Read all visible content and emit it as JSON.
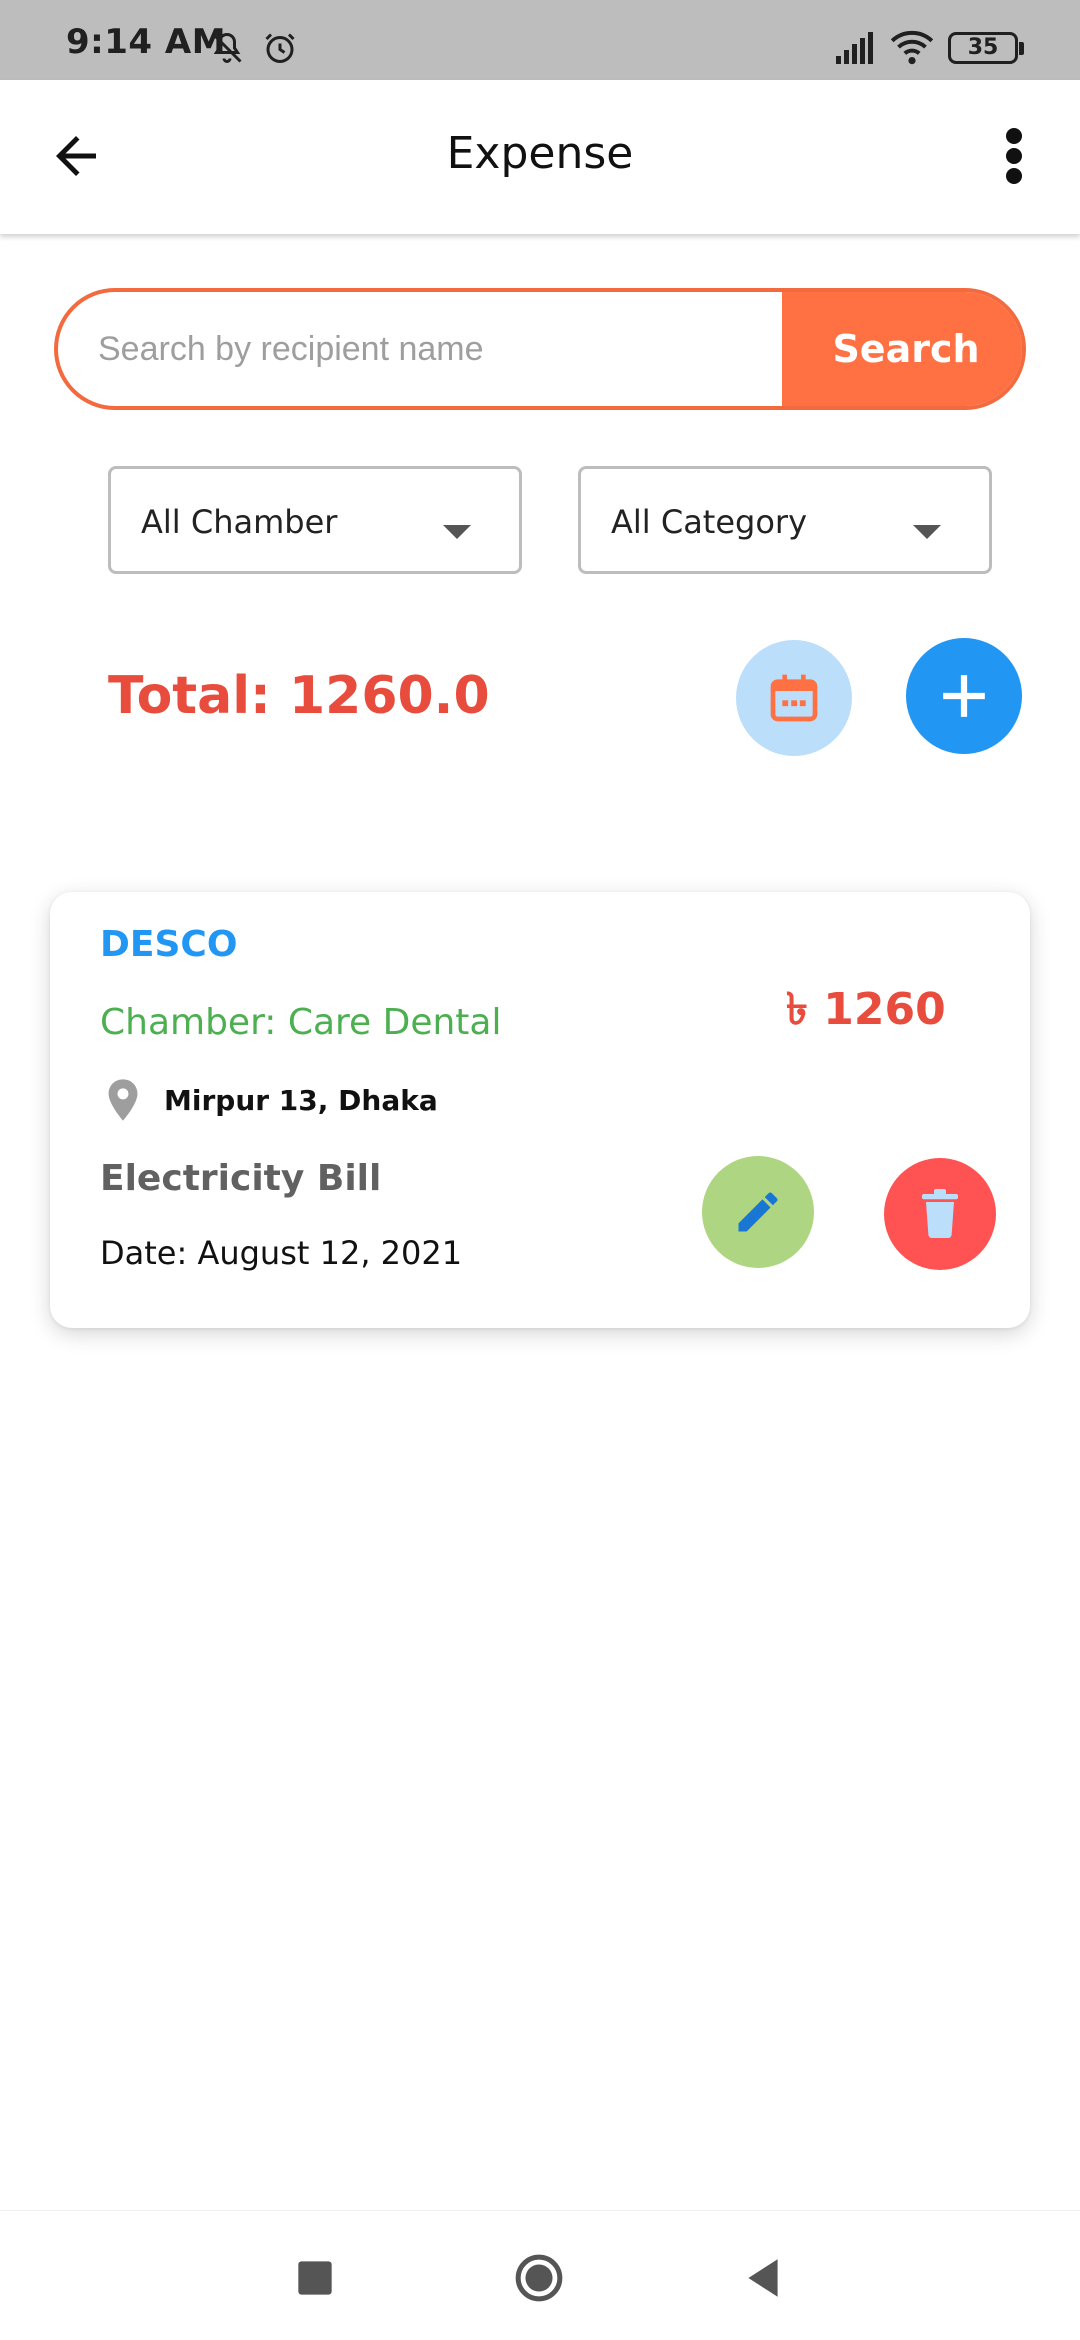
{
  "status_bar": {
    "time": "9:14 AM",
    "battery": "35",
    "icons": [
      "mute-icon",
      "alarm-icon",
      "signal-icon",
      "wifi-icon",
      "battery-icon"
    ]
  },
  "app_bar": {
    "title": "Expense",
    "icons": [
      "back-arrow-icon",
      "more-vert-icon"
    ]
  },
  "search": {
    "placeholder": "Search by recipient name",
    "value": "",
    "button_label": "Search"
  },
  "filters": {
    "chamber": "All Chamber",
    "category": "All Category"
  },
  "summary": {
    "total": "Total: 1260.0"
  },
  "expenses": [
    {
      "recipient": "DESCO",
      "chamber": "Chamber: Care Dental",
      "amount": "৳ 1260",
      "location": "Mirpur 13, Dhaka",
      "category": "Electricity Bill",
      "date": "Date: August 12, 2021"
    }
  ],
  "colors": {
    "accent_orange": "#ff7043",
    "total_red": "#e74c3c",
    "recipient_blue": "#2196f3",
    "chamber_green": "#4caf50",
    "edit_green": "#aed581",
    "delete_red": "#ff5252",
    "calendar_bg": "#bbdefb"
  }
}
